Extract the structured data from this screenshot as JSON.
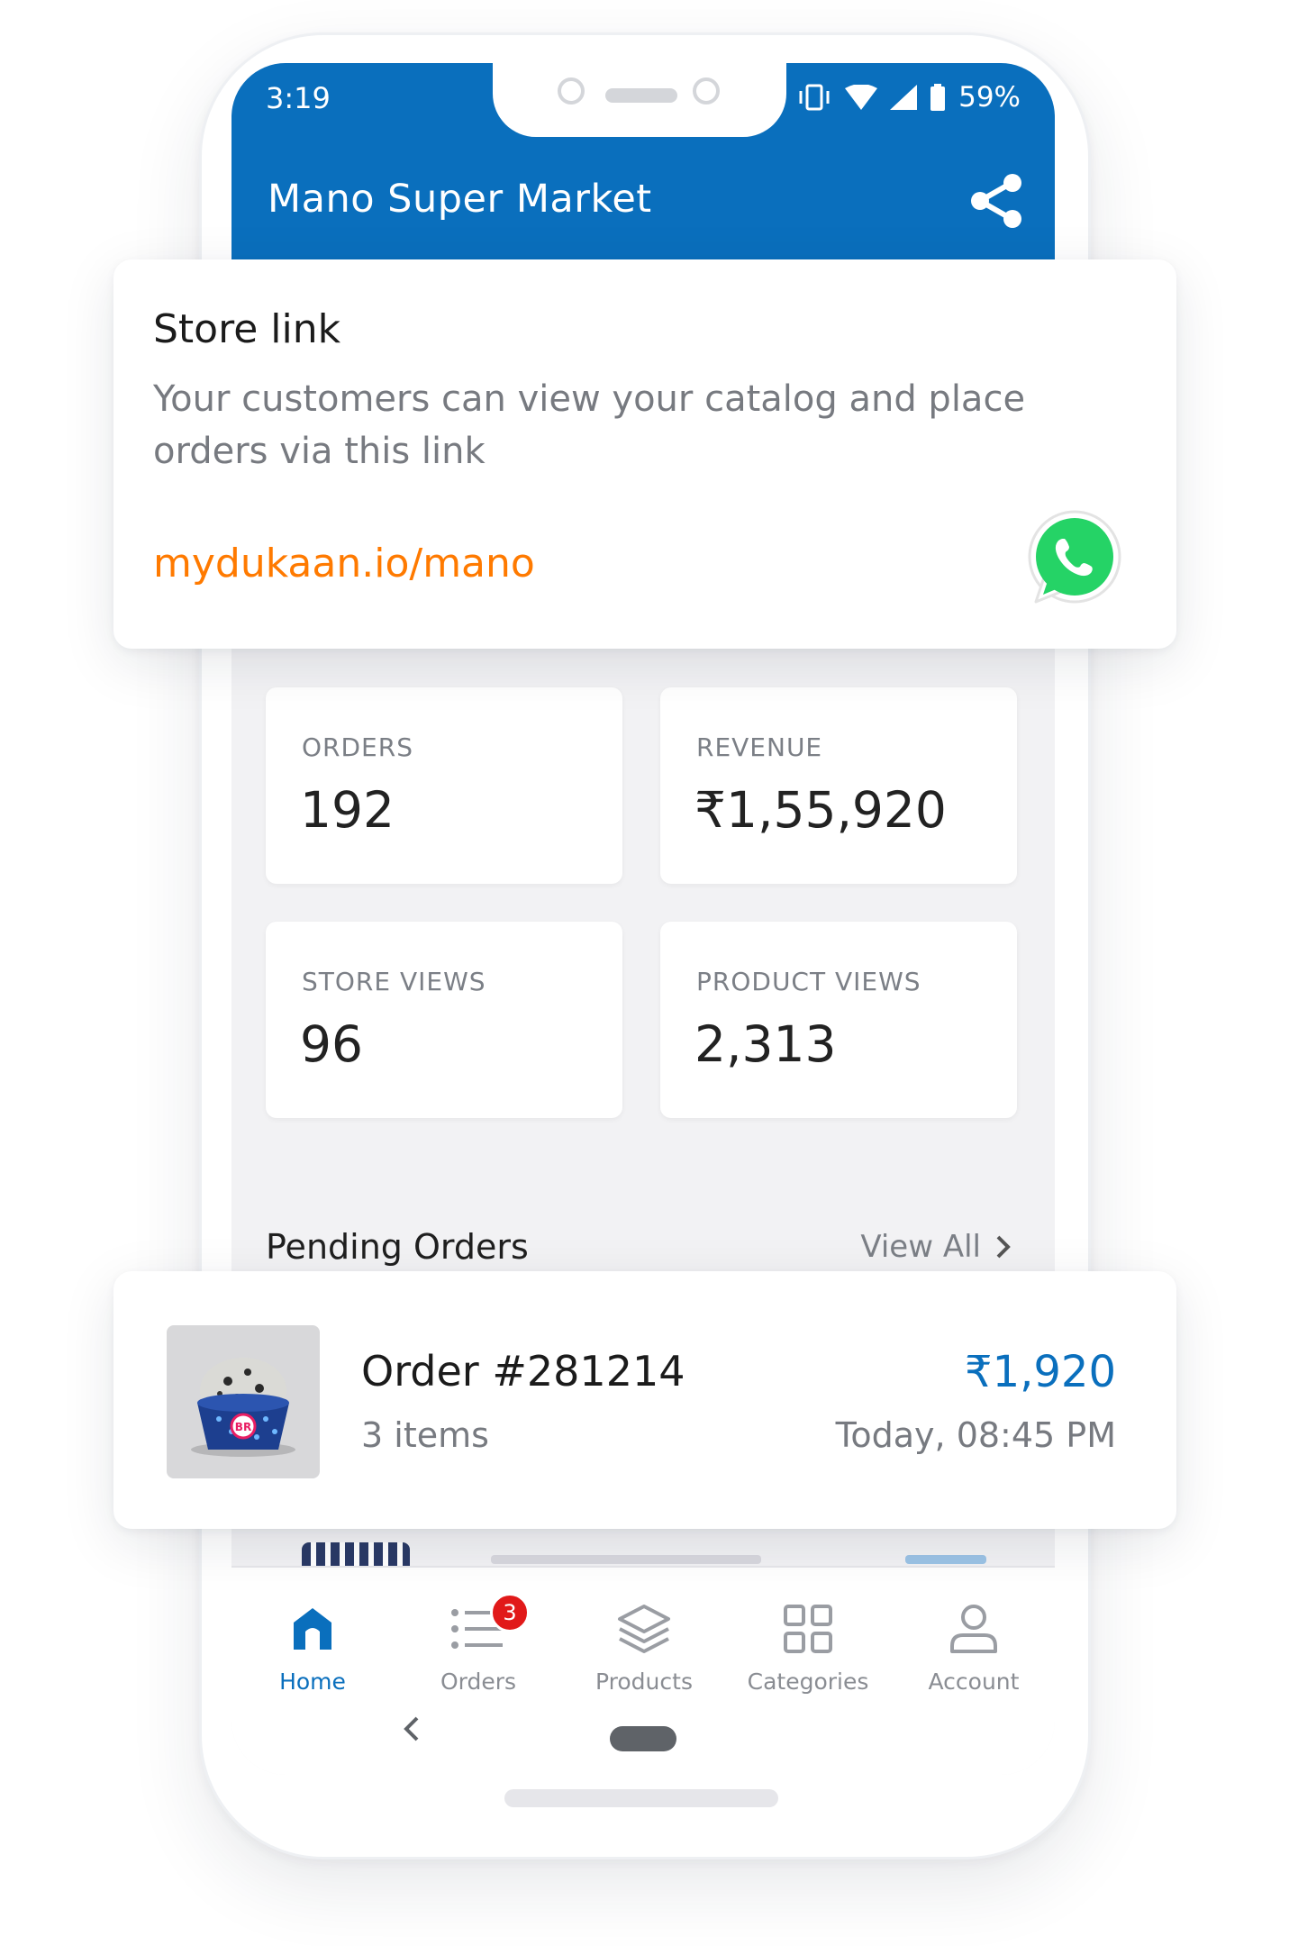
{
  "status_bar": {
    "time": "3:19",
    "battery": "59%"
  },
  "app_bar": {
    "title": "Mano Super Market"
  },
  "store_link_card": {
    "title": "Store link",
    "description": "Your customers can view your catalog and place orders via this link",
    "link": "mydukaan.io/mano"
  },
  "stats": [
    {
      "label": "ORDERS",
      "value": "192"
    },
    {
      "label": "REVENUE",
      "value": "₹1,55,920"
    },
    {
      "label": "STORE VIEWS",
      "value": "96"
    },
    {
      "label": "PRODUCT VIEWS",
      "value": "2,313"
    }
  ],
  "pending_orders": {
    "title": "Pending Orders",
    "view_all": "View All"
  },
  "order": {
    "number": "Order #281214",
    "items": "3 items",
    "amount": "₹1,920",
    "date": "Today, 08:45 PM",
    "thumb_mark": "BR"
  },
  "bottom_nav": {
    "items": [
      {
        "label": "Home",
        "active": true
      },
      {
        "label": "Orders",
        "badge": "3"
      },
      {
        "label": "Products"
      },
      {
        "label": "Categories"
      },
      {
        "label": "Account"
      }
    ]
  },
  "colors": {
    "primary": "#0a6fbd",
    "link": "#ff7a00",
    "whatsapp": "#25d366",
    "badge": "#e11919"
  }
}
